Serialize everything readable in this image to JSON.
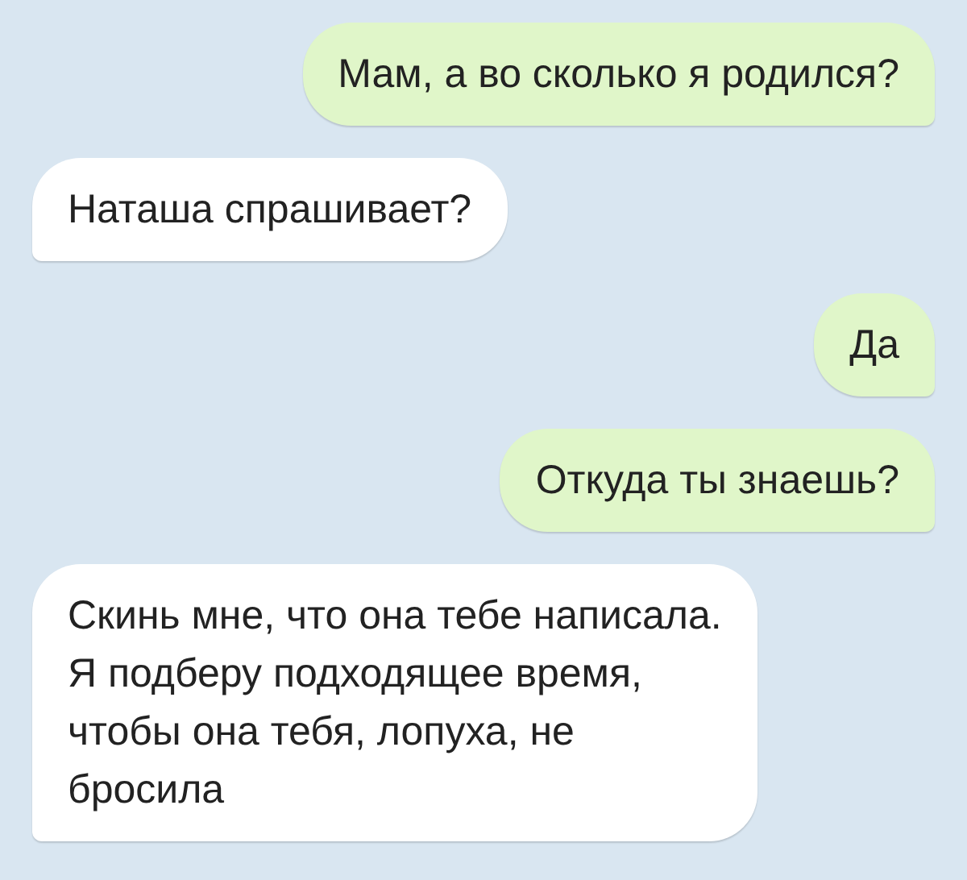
{
  "messages": [
    {
      "kind": "outgoing",
      "text": "Мам, а во сколько я родился?"
    },
    {
      "kind": "incoming",
      "text": "Наташа спрашивает?"
    },
    {
      "kind": "outgoing",
      "text": "Да"
    },
    {
      "kind": "outgoing",
      "text": "Откуда ты знаешь?"
    },
    {
      "kind": "incoming",
      "text": "Скинь мне, что она тебе написала. Я подберу подходящее время, чтобы она тебя, лопуха, не бросила"
    }
  ]
}
